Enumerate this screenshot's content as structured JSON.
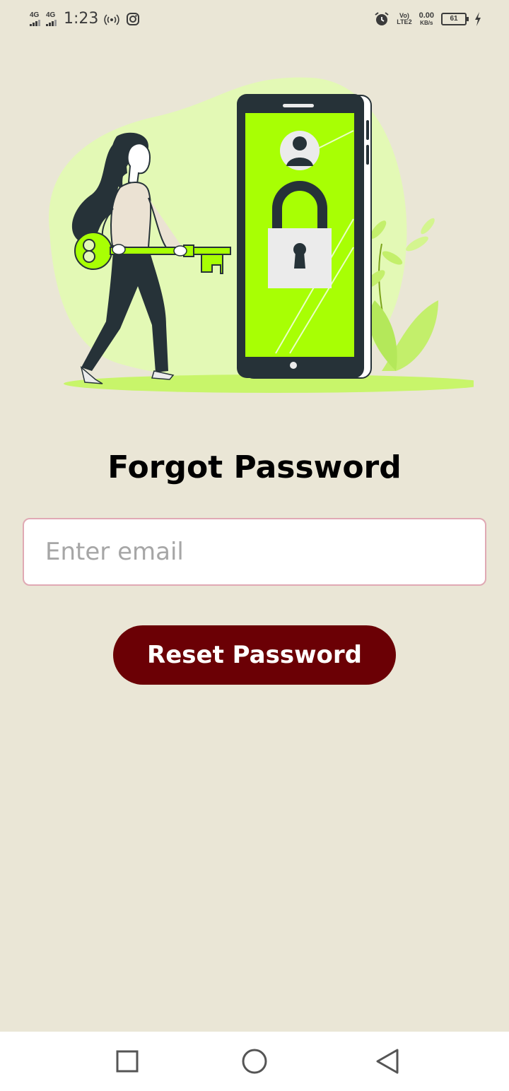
{
  "status_bar": {
    "signal_1": "4G",
    "signal_2": "4G",
    "time": "1:23",
    "volte_label": "Vo)",
    "lte_label": "LTE2",
    "net_speed_value": "0.00",
    "net_speed_unit": "KB/s",
    "battery_level": "61",
    "icons": [
      "hotspot-icon",
      "instagram-icon",
      "alarm-icon",
      "charging-icon"
    ]
  },
  "illustration": {
    "icon": "woman-with-key-unlocking-phone-illustration",
    "colors": {
      "blob": "#E3F9B5",
      "screen": "#A8FF04",
      "phone_body": "#263238",
      "lock": "#EBEBEB",
      "ground": "#C8F56A"
    }
  },
  "page": {
    "title": "Forgot Password"
  },
  "form": {
    "email_placeholder": "Enter email",
    "email_value": "",
    "submit_label": "Reset Password"
  },
  "colors": {
    "background": "#EAE6D6",
    "button": "#6B0005",
    "input_border": "#E0A9B4"
  },
  "nav_bar": {
    "icons": [
      "recent-apps-icon",
      "home-icon",
      "back-icon"
    ]
  }
}
